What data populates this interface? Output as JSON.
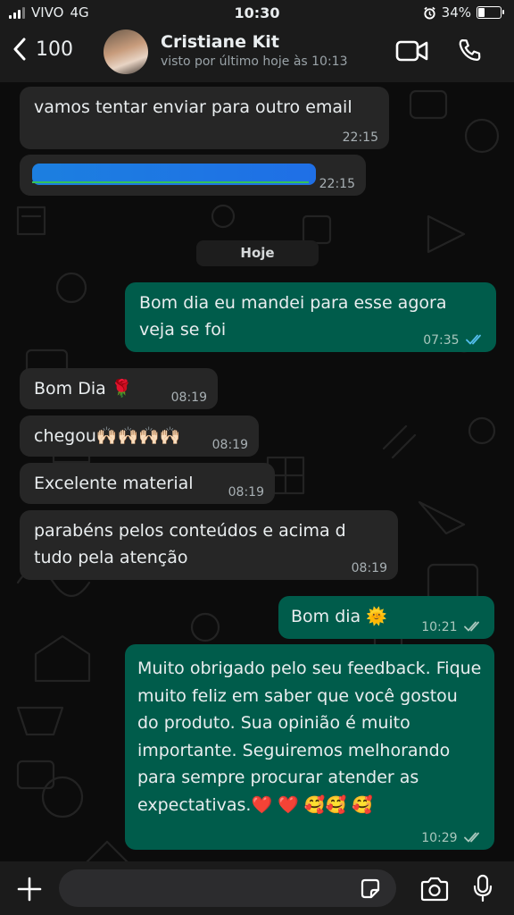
{
  "status_bar": {
    "carrier": "VIVO",
    "network": "4G",
    "time": "10:30",
    "battery": "34%",
    "battery_level": 0.34
  },
  "header": {
    "unread_count": "100",
    "contact_name": "Cristiane Kit",
    "last_seen": "visto por último hoje às 10:13"
  },
  "date_separator": "Hoje",
  "messages": [
    {
      "dir": "in",
      "text": "vamos tentar enviar para outro email",
      "time": "22:15"
    },
    {
      "dir": "in",
      "text": "",
      "time": "22:15",
      "redacted": true
    },
    {
      "dir": "out",
      "text": "Bom dia eu mandei para esse agora veja se foi",
      "time": "07:35",
      "status": "read"
    },
    {
      "dir": "in",
      "text": "Bom Dia 🌹",
      "time": "08:19"
    },
    {
      "dir": "in",
      "text": "chegou🙌🏻🙌🏻🙌🏻🙌🏻",
      "time": "08:19"
    },
    {
      "dir": "in",
      "text": "Excelente material",
      "time": "08:19"
    },
    {
      "dir": "in",
      "text": "parabéns pelos conteúdos e acima d tudo pela atenção",
      "time": "08:19"
    },
    {
      "dir": "out",
      "text": "Bom dia 🌞",
      "time": "10:21",
      "status": "delivered"
    },
    {
      "dir": "out",
      "text": "Muito obrigado pelo seu feedback. Fique muito feliz em saber que você gostou do produto. Sua opinião é muito importante. Seguiremos melhorando para sempre procurar atender as expectativas.❤️ ❤️ 🥰🥰 🥰",
      "time": "10:29",
      "status": "delivered"
    }
  ],
  "colors": {
    "incoming": "#262626",
    "outgoing": "#005c4b",
    "read_ticks": "#53bdeb"
  }
}
